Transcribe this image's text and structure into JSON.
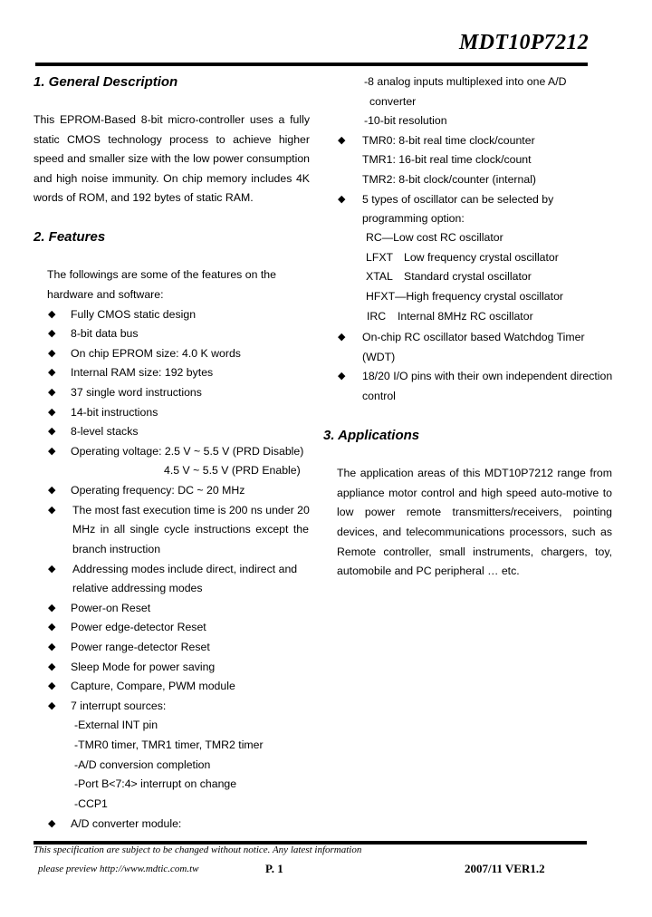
{
  "header": {
    "title": "MDT10P7212"
  },
  "sections": {
    "general": {
      "heading": "1. General Description",
      "lines": [
        "This EPROM-Based 8-bit micro-controller uses a fully",
        "static CMOS technology process to achieve higher",
        "speed and smaller size with the low power consumption",
        "and high noise immunity. On chip memory includes 4K",
        "words of ROM, and 192 bytes of static RAM."
      ]
    },
    "features": {
      "heading": "2. Features",
      "intro": [
        "The followings are some of the features on the",
        "hardware and software:"
      ],
      "items": [
        "Fully CMOS static design",
        "8-bit data bus",
        "On chip EPROM size: 4.0 K words",
        "Internal RAM size: 192 bytes",
        "37 single word instructions",
        "14-bit instructions",
        "8-level stacks",
        "Operating voltage: 2.5 V ~ 5.5 V (PRD Disable)",
        "Operating frequency: DC ~ 20 MHz",
        "The most fast execution time is 200 ns under 20",
        "Addressing modes include direct, indirect and",
        "Power-on Reset",
        "Power edge-detector Reset",
        "Power range-detector Reset",
        "Sleep Mode for power saving",
        "Capture, Compare, PWM module",
        "7 interrupt sources:",
        "A/D converter module:"
      ],
      "voltage_cont": "4.5 V ~ 5.5 V (PRD Enable)",
      "exec_cont": [
        "MHz in all single cycle instructions except the",
        "branch instruction"
      ],
      "addr_cont": "relative addressing modes",
      "interrupts": [
        "-External INT pin",
        "-TMR0 timer, TMR1 timer, TMR2 timer",
        "-A/D conversion completion",
        "-Port B<7:4> interrupt on change",
        "-CCP1"
      ],
      "adc": [
        "-8 analog inputs multiplexed into one A/D",
        "converter",
        "-10-bit resolution"
      ],
      "timers": [
        "TMR0: 8-bit real time clock/counter",
        "TMR1: 16-bit real time clock/count",
        "TMR2: 8-bit clock/counter (internal)"
      ],
      "osc_item": [
        "5 types of oscillator can be selected by",
        "programming option:"
      ],
      "oscillators": [
        {
          "name": "RC",
          "sep": "—",
          "desc": "Low cost RC oscillator"
        },
        {
          "name": "LFXT",
          "sep": "",
          "desc": "Low frequency crystal oscillator"
        },
        {
          "name": "XTAL",
          "sep": "",
          "desc": "Standard crystal oscillator"
        },
        {
          "name": "HFXT",
          "sep": "—",
          "desc": "High frequency crystal oscillator"
        },
        {
          "name": "IRC",
          "sep": "",
          "desc": "Internal 8MHz RC oscillator"
        }
      ],
      "wdt": [
        "On-chip RC oscillator based Watchdog Timer",
        "(WDT)"
      ],
      "io": [
        "18/20 I/O pins with their own independent direction",
        "control"
      ]
    },
    "applications": {
      "heading": "3. Applications",
      "lines": [
        "The application areas of this MDT10P7212 range from",
        "appliance motor control and high speed auto-motive to",
        "low power remote transmitters/receivers, pointing",
        "devices, and telecommunications processors, such as",
        "Remote controller, small instruments, chargers, toy,",
        "automobile and PC peripheral … etc."
      ]
    }
  },
  "bullet_glyph": "◆",
  "footer": {
    "notice": "This specification are subject to be changed without notice. Any latest information",
    "preview": "please preview http://www.mdtic.com.tw",
    "page": "P. 1",
    "version": "2007/11 VER1.2"
  }
}
